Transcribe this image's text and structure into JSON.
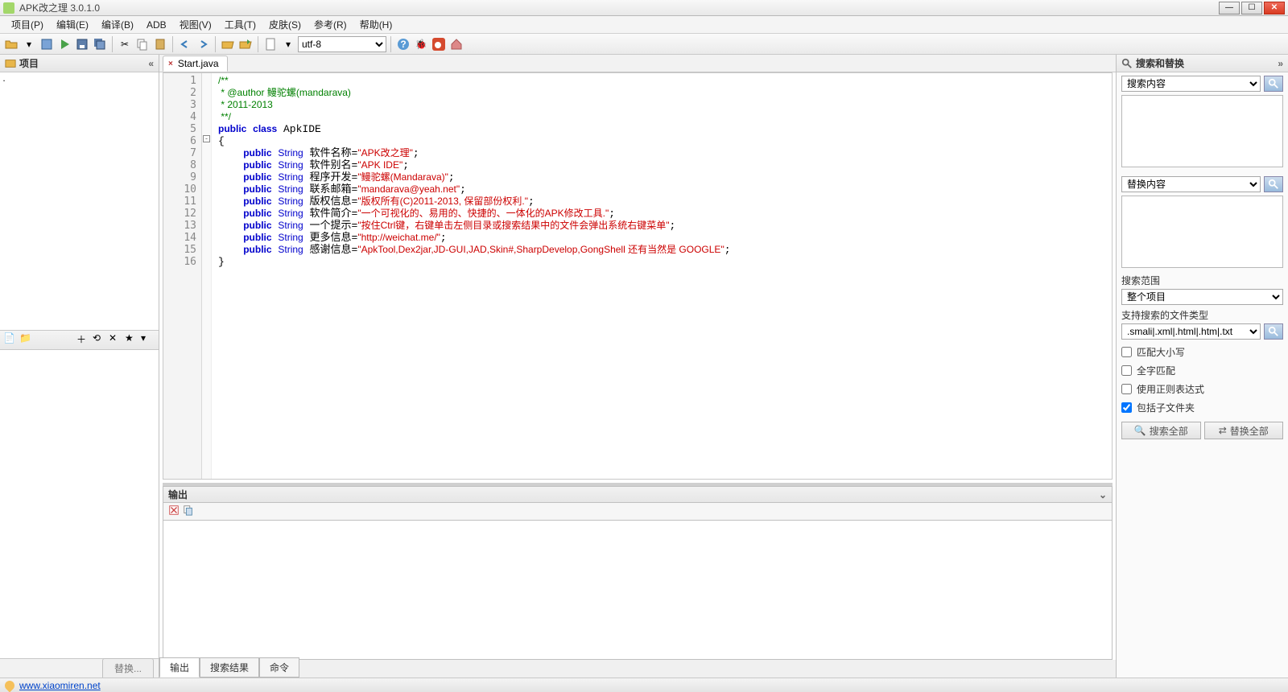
{
  "app": {
    "title": "APK改之理 3.0.1.0"
  },
  "menu": [
    "项目(P)",
    "编辑(E)",
    "编译(B)",
    "ADB",
    "视图(V)",
    "工具(T)",
    "皮肤(S)",
    "参考(R)",
    "帮助(H)"
  ],
  "toolbar": {
    "encoding": "utf-8"
  },
  "left_panel": {
    "title": "项目",
    "bottom_tab": "替换..."
  },
  "editor": {
    "tab_name": "Start.java",
    "lines": [
      {
        "n": 1,
        "html": "<span class='c-comment'>/**</span>"
      },
      {
        "n": 2,
        "html": "<span class='c-comment'> * @author 鳗驼螺(mandarava)</span>"
      },
      {
        "n": 3,
        "html": "<span class='c-comment'> * 2011-2013</span>"
      },
      {
        "n": 4,
        "html": "<span class='c-comment'> **/</span>"
      },
      {
        "n": 5,
        "html": "<span class='c-key'>public</span> <span class='c-key'>class</span> ApkIDE"
      },
      {
        "n": 6,
        "html": "{"
      },
      {
        "n": 7,
        "html": "    <span class='c-key'>public</span> <span class='c-type'>String</span> 软件名称=<span class='c-str'>\"APK改之理\"</span>;"
      },
      {
        "n": 8,
        "html": "    <span class='c-key'>public</span> <span class='c-type'>String</span> 软件别名=<span class='c-str'>\"APK IDE\"</span>;"
      },
      {
        "n": 9,
        "html": "    <span class='c-key'>public</span> <span class='c-type'>String</span> 程序开发=<span class='c-str'>\"鳗驼螺(Mandarava)\"</span>;"
      },
      {
        "n": 10,
        "html": "    <span class='c-key'>public</span> <span class='c-type'>String</span> 联系邮箱=<span class='c-str'>\"mandarava@yeah.net\"</span>;"
      },
      {
        "n": 11,
        "html": "    <span class='c-key'>public</span> <span class='c-type'>String</span> 版权信息=<span class='c-str'>\"版权所有(C)2011-2013, 保留部份权利.\"</span>;"
      },
      {
        "n": 12,
        "html": "    <span class='c-key'>public</span> <span class='c-type'>String</span> 软件简介=<span class='c-str'>\"一个可视化的、易用的、快捷的、一体化的APK修改工具.\"</span>;"
      },
      {
        "n": 13,
        "html": "    <span class='c-key'>public</span> <span class='c-type'>String</span> 一个提示=<span class='c-str'>\"按住Ctrl键，右键单击左侧目录或搜索结果中的文件会弹出系统右键菜单\"</span>;"
      },
      {
        "n": 14,
        "html": "    <span class='c-key'>public</span> <span class='c-type'>String</span> 更多信息=<span class='c-str'>\"http://weichat.me/\"</span>;"
      },
      {
        "n": 15,
        "html": "    <span class='c-key'>public</span> <span class='c-type'>String</span> 感谢信息=<span class='c-str'>\"ApkTool,Dex2jar,JD-GUI,JAD,Skin#,SharpDevelop,GongShell 还有当然是 GOOGLE\"</span>;"
      },
      {
        "n": 16,
        "html": "}"
      }
    ]
  },
  "output": {
    "title": "输出"
  },
  "bottom_tabs": [
    "输出",
    "搜索结果",
    "命令"
  ],
  "right_panel": {
    "title": "搜索和替换",
    "search_label": "搜索内容",
    "replace_label": "替换内容",
    "scope_label": "搜索范围",
    "scope_value": "整个项目",
    "filetypes_label": "支持搜索的文件类型",
    "filetypes_value": ".smali|.xml|.html|.htm|.txt",
    "checks": [
      {
        "label": "匹配大小写",
        "checked": false
      },
      {
        "label": "全字匹配",
        "checked": false
      },
      {
        "label": "使用正则表达式",
        "checked": false
      },
      {
        "label": "包括子文件夹",
        "checked": true
      }
    ],
    "search_all": "搜索全部",
    "replace_all": "替换全部"
  },
  "status": {
    "link": "www.xiaomiren.net"
  }
}
